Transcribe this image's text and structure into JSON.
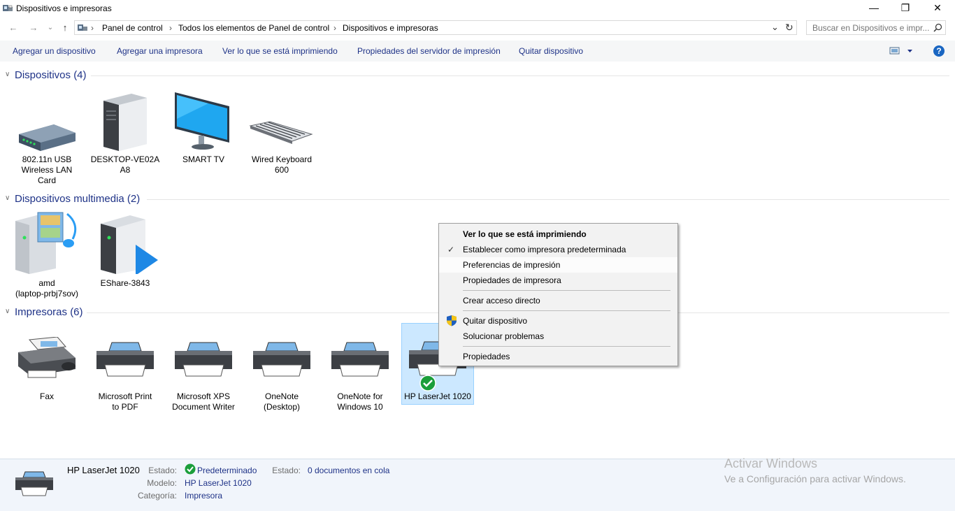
{
  "window": {
    "title": "Dispositivos e impresoras",
    "minimize": "—",
    "restore": "❐",
    "close": "✕"
  },
  "nav": {
    "back": "←",
    "forward": "→",
    "recent": "⌄",
    "up": "↑"
  },
  "address": {
    "crumbs": [
      "Panel de control",
      "Todos los elementos de Panel de control",
      "Dispositivos e impresoras"
    ],
    "separator": "›",
    "dropdown": "⌄",
    "refresh": "↻"
  },
  "search": {
    "placeholder": "Buscar en Dispositivos e impr..."
  },
  "commands": {
    "add_device": "Agregar un dispositivo",
    "add_printer": "Agregar una impresora",
    "see_printing": "Ver lo que se está imprimiendo",
    "server_props": "Propiedades del servidor de impresión",
    "remove_device": "Quitar dispositivo",
    "help": "?"
  },
  "groups": {
    "devices": {
      "title": "Dispositivos (4)",
      "items": [
        {
          "line1": "802.11n USB",
          "line2": "Wireless LAN",
          "line3": "Card"
        },
        {
          "line1": "DESKTOP-VE02A",
          "line2": "A8",
          "line3": ""
        },
        {
          "line1": "SMART TV",
          "line2": "",
          "line3": ""
        },
        {
          "line1": "Wired Keyboard",
          "line2": "600",
          "line3": ""
        }
      ]
    },
    "multimedia": {
      "title": "Dispositivos multimedia (2)",
      "items": [
        {
          "line1": "amd",
          "line2": "(laptop-prbj7sov)"
        },
        {
          "line1": "EShare-3843",
          "line2": ""
        }
      ]
    },
    "printers": {
      "title": "Impresoras (6)",
      "items": [
        {
          "line1": "Fax",
          "line2": ""
        },
        {
          "line1": "Microsoft Print",
          "line2": "to PDF"
        },
        {
          "line1": "Microsoft XPS",
          "line2": "Document Writer"
        },
        {
          "line1": "OneNote",
          "line2": "(Desktop)"
        },
        {
          "line1": "OneNote for",
          "line2": "Windows 10"
        },
        {
          "line1": "HP LaserJet 1020",
          "line2": ""
        }
      ]
    }
  },
  "context_menu": {
    "see_printing": "Ver lo que se está imprimiendo",
    "set_default": "Establecer como impresora predeterminada",
    "prefs": "Preferencias de impresión",
    "printer_props": "Propiedades de impresora",
    "shortcut": "Crear acceso directo",
    "remove": "Quitar dispositivo",
    "troubleshoot": "Solucionar problemas",
    "properties": "Propiedades",
    "check": "✓"
  },
  "details": {
    "name": "HP LaserJet 1020",
    "estado_label": "Estado:",
    "estado_value": "Predeterminado",
    "estado2_label": "Estado:",
    "estado2_value": "0 documentos en cola",
    "modelo_label": "Modelo:",
    "modelo_value": "HP LaserJet 1020",
    "categoria_label": "Categoría:",
    "categoria_value": "Impresora"
  },
  "watermark": {
    "line1": "Activar Windows",
    "line2": "Ve a Configuración para activar Windows."
  },
  "colors": {
    "accent": "#1e3287",
    "selection": "#cce8ff",
    "selection_border": "#99d1ff",
    "check_green": "#1b9e3a"
  }
}
